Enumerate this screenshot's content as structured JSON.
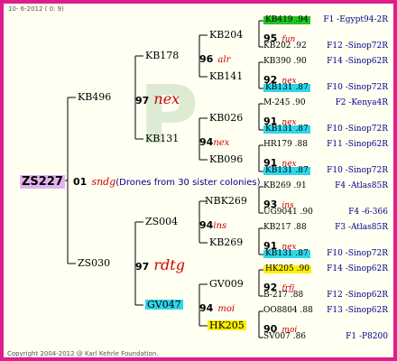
{
  "header": "10-  6-2012 (  0:  9)",
  "footer": "Copyright 2004-2012 @ Karl Kehrle Foundation.",
  "watermark": "P",
  "root": {
    "name": "ZS227",
    "year": "01",
    "mark": "sndg",
    "note": "(Drones from 30 sister colonies)"
  },
  "gen1": [
    {
      "name": "KB496",
      "year": "97",
      "mark": "nex"
    },
    {
      "name": "ZS030",
      "year": "97",
      "mark": "rdtg"
    }
  ],
  "gen2": [
    {
      "name": "KB178",
      "year": "96",
      "mark": "alr"
    },
    {
      "name": "KB131",
      "year": "94",
      "mark": "nex"
    },
    {
      "name": "ZS004",
      "year": "94",
      "mark": "ins"
    },
    {
      "name": "GV047",
      "year": "94",
      "mark": "moi"
    }
  ],
  "gen3": [
    {
      "name": "KB204",
      "year": "95",
      "mark": "fun"
    },
    {
      "name": "KB141",
      "year": "92",
      "mark": "nex"
    },
    {
      "name": "KB026",
      "year": "91",
      "mark": "nex"
    },
    {
      "name": "KB096",
      "year": "91",
      "mark": "nex"
    },
    {
      "name": "NBK269",
      "year": "93",
      "mark": "ins"
    },
    {
      "name": "KB269",
      "year": "91",
      "mark": "nex"
    },
    {
      "name": "GV009",
      "year": "92",
      "mark": "frfj"
    },
    {
      "name": "HK205",
      "year": "90",
      "mark": "moi"
    }
  ],
  "gen4": [
    {
      "name": "KB419 .94",
      "loc": "F1 -Egypt94-2R"
    },
    {
      "name": "KB202 .92",
      "loc": "F12 -Sinop72R"
    },
    {
      "name": "KB390 .90",
      "loc": "F14 -Sinop62R"
    },
    {
      "name": "KB131 .87",
      "loc": "F10 -Sinop72R"
    },
    {
      "name": "M-245 .90",
      "loc": "F2 -Kenya4R"
    },
    {
      "name": "KB131 .87",
      "loc": "F10 -Sinop72R"
    },
    {
      "name": "HR179 .88",
      "loc": "F11 -Sinop62R"
    },
    {
      "name": "KB131 .87",
      "loc": "F10 -Sinop72R"
    },
    {
      "name": "KB269 .91",
      "loc": "F4 -Atlas85R"
    },
    {
      "name": "UG9041 .90",
      "loc": "F4 -6-366"
    },
    {
      "name": "KB217 .88",
      "loc": "F3 -Atlas85R"
    },
    {
      "name": "KB131 .87",
      "loc": "F10 -Sinop72R"
    },
    {
      "name": "HK205 .90",
      "loc": "F14 -Sinop62R"
    },
    {
      "name": "B-217 .88",
      "loc": "F12 -Sinop62R"
    },
    {
      "name": "OO8804 .88",
      "loc": "F13 -Sinop62R"
    },
    {
      "name": "SV007 .86",
      "loc": "F1 -P8200"
    }
  ],
  "colors": {
    "border": "#dd1e8c",
    "green": "#22c322",
    "cyan": "#2ed6ea",
    "yellow": "#ffee00",
    "root": "#e4b2ee",
    "lines": "#000000"
  }
}
